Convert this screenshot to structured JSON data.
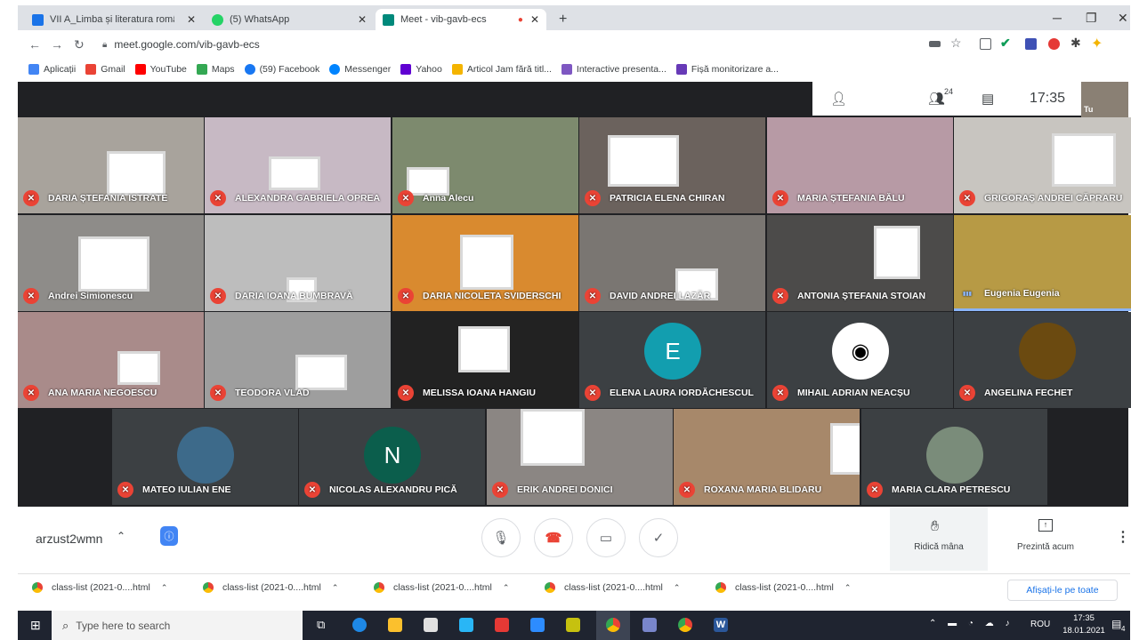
{
  "browser": {
    "tabs": [
      {
        "title": "VII A_Limba și literatura română",
        "icon_color": "#1a73e8"
      },
      {
        "title": "(5) WhatsApp",
        "icon_color": "#25d366"
      },
      {
        "title": "Meet - vib-gavb-ecs",
        "icon_color": "#00897b",
        "recording": true
      }
    ],
    "new_tab": "+",
    "url": "meet.google.com/vib-gavb-ecs",
    "bookmarks": [
      {
        "label": "Aplicații",
        "color": "#4285f4"
      },
      {
        "label": "Gmail",
        "color": "#ea4335"
      },
      {
        "label": "YouTube",
        "color": "#ff0000"
      },
      {
        "label": "Maps",
        "color": "#34a853"
      },
      {
        "label": "(59) Facebook",
        "color": "#1877f2"
      },
      {
        "label": "Messenger",
        "color": "#0084ff"
      },
      {
        "label": "Yahoo",
        "color": "#6001d2"
      },
      {
        "label": "Articol Jam fără titl...",
        "color": "#f4b400"
      },
      {
        "label": "Interactive presenta...",
        "color": "#7e57c2"
      },
      {
        "label": "Fișă monitorizare a...",
        "color": "#673ab7"
      }
    ]
  },
  "meet": {
    "participants_count": "24",
    "time": "17:35",
    "self_label": "Tu",
    "tiles": [
      {
        "name": "DARIA ȘTEFANIA ISTRATE",
        "bg": "#a8a39c",
        "mic": "muted"
      },
      {
        "name": "ALEXANDRA GABRIELA OPREA",
        "bg": "#c7b9c4",
        "mic": "muted"
      },
      {
        "name": "Anna Alecu",
        "bg": "#7d8a6e",
        "mic": "muted"
      },
      {
        "name": "PATRICIA ELENA CHIRAN",
        "bg": "#6b625d",
        "mic": "muted"
      },
      {
        "name": "MARIA ȘTEFANIA BĂLU",
        "bg": "#b79aa5",
        "mic": "muted"
      },
      {
        "name": "GRIGORAȘ ANDREI CĂPRARU",
        "bg": "#c8c5c0",
        "mic": "muted"
      },
      {
        "name": "Andrei Simionescu",
        "bg": "#8e8c89",
        "mic": "muted"
      },
      {
        "name": "DARIA IOANA BUMBRAVĂ",
        "bg": "#bdbdbd",
        "mic": "muted"
      },
      {
        "name": "DARIA NICOLETA SVIDERSCHI",
        "bg": "#d98a2f",
        "mic": "muted"
      },
      {
        "name": "DAVID ANDREI LAZĂR",
        "bg": "#7a7672",
        "mic": "muted"
      },
      {
        "name": "ANTONIA ȘTEFANIA STOIAN",
        "bg": "#4c4b4a",
        "mic": "muted"
      },
      {
        "name": "Eugenia Eugenia",
        "bg": "#b79a45",
        "mic": "speaking"
      },
      {
        "name": "ANA MARIA NEGOESCU",
        "bg": "#a98b8a",
        "mic": "muted"
      },
      {
        "name": "TEODORA VLAD",
        "bg": "#9e9e9e",
        "mic": "muted"
      },
      {
        "name": "MELISSA IOANA HANGIU",
        "bg": "#222222",
        "mic": "muted"
      },
      {
        "name": "ELENA LAURA IORDĂCHESCUL",
        "bg": "#3c4043",
        "mic": "muted",
        "avatar": "E",
        "avatar_color": "#129eaf"
      },
      {
        "name": "MIHAIL ADRIAN NEACȘU",
        "bg": "#3c4043",
        "mic": "muted",
        "avatar_icon": "mask",
        "avatar_color": "#ffffff"
      },
      {
        "name": "ANGELINA FECHET",
        "bg": "#3c4043",
        "mic": "muted",
        "avatar_icon": "photo",
        "avatar_color": "#6b4a10"
      },
      {
        "name": "MATEO IULIAN ENE",
        "bg": "#3c4043",
        "mic": "muted",
        "avatar_icon": "photo",
        "avatar_color": "#3d6a8a"
      },
      {
        "name": "NICOLAS ALEXANDRU PICĂ",
        "bg": "#3c4043",
        "mic": "muted",
        "avatar": "N",
        "avatar_color": "#0b5e4c"
      },
      {
        "name": "ERIK ANDREI DONICI",
        "bg": "#8b8683",
        "mic": "muted"
      },
      {
        "name": "ROXANA MARIA BLIDARU",
        "bg": "#a7886a",
        "mic": "muted"
      },
      {
        "name": "MARIA CLARA PETRESCU",
        "bg": "#3c4043",
        "mic": "muted",
        "avatar_icon": "photo",
        "avatar_color": "#7a8c7a"
      }
    ],
    "meeting_code": "arzust2wmn",
    "raise_hand": "Ridică mâna",
    "present_now": "Prezintă acum"
  },
  "downloads": {
    "items": [
      "class-list (2021-0....html",
      "class-list (2021-0....html",
      "class-list (2021-0....html",
      "class-list (2021-0....html",
      "class-list (2021-0....html"
    ],
    "show_all": "Afișați-le pe toate"
  },
  "taskbar": {
    "search_placeholder": "Type here to search",
    "lang": "ROU",
    "time": "17:35",
    "date": "18.01.2021",
    "notif_count": "4"
  }
}
